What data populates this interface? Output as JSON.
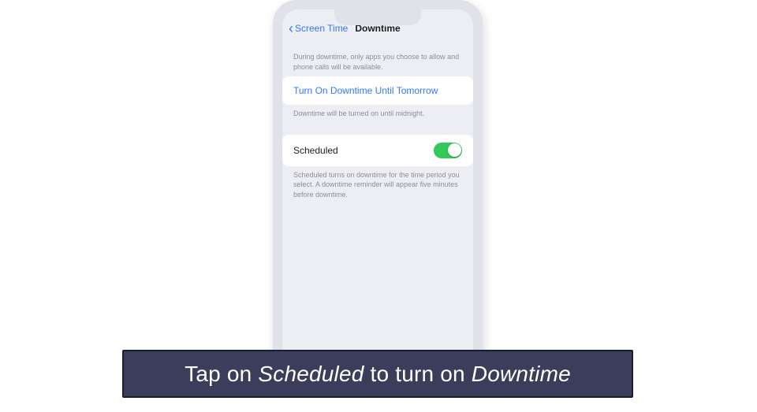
{
  "nav": {
    "back_label": "Screen Time",
    "title": "Downtime"
  },
  "intro": "During downtime, only apps you choose to allow and phone calls will be available.",
  "turn_on": {
    "label": "Turn On Downtime Until Tomorrow",
    "footer": "Downtime will be turned on until midnight."
  },
  "scheduled": {
    "label": "Scheduled",
    "toggle_on": true,
    "footer": "Scheduled turns on downtime for the time period you select. A downtime reminder will appear five minutes before downtime."
  },
  "caption": {
    "prefix": "Tap on ",
    "em1": "Scheduled",
    "mid": " to turn on ",
    "em2": "Downtime"
  }
}
